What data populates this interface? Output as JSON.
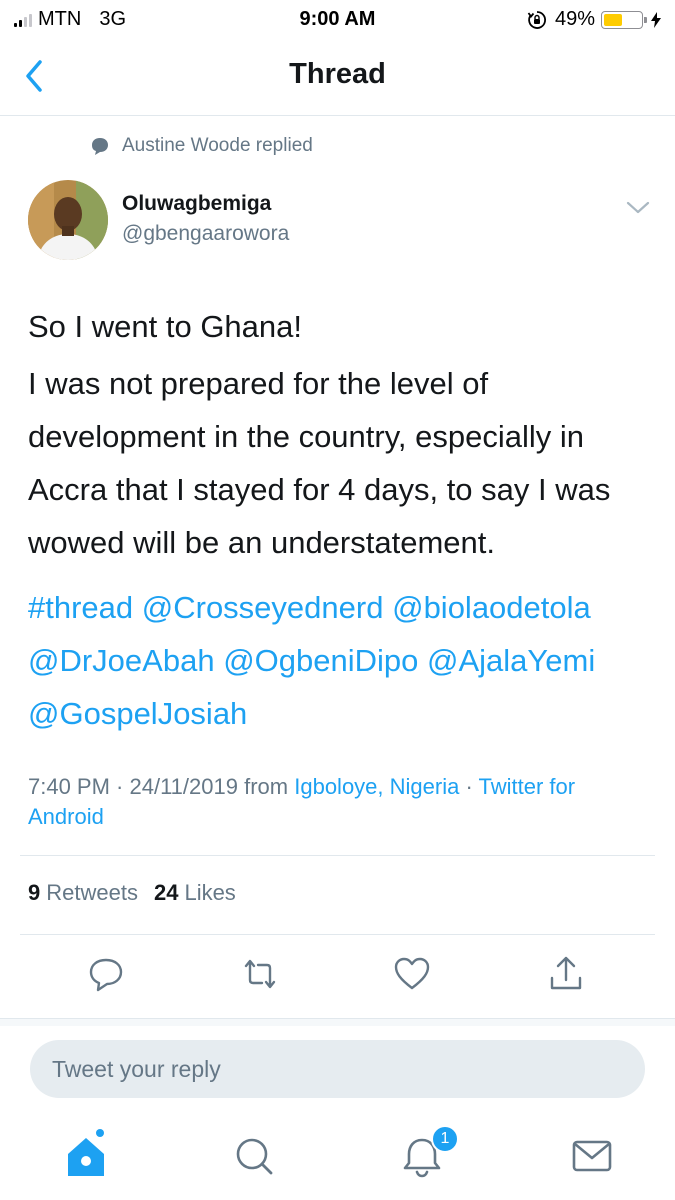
{
  "status_bar": {
    "carrier": "MTN",
    "network": "3G",
    "time": "9:00 AM",
    "battery_percent": "49%",
    "battery_level": 0.49,
    "signal_bars": 2,
    "icons": [
      "signal-icon",
      "orientation-lock-icon",
      "battery-icon",
      "charging-bolt-icon"
    ]
  },
  "nav": {
    "title": "Thread",
    "back_icon": "chevron-left-icon"
  },
  "tweet": {
    "reply_context": "Austine Woode replied",
    "author_name": "Oluwagbemiga",
    "author_handle": "@gbengaarowora",
    "line1": "So I went to Ghana!",
    "line2": "I was not prepared for the level of development in the country, especially in Accra that I stayed for 4 days, to say I was wowed will be an understatement.",
    "hashtag": "#thread",
    "mentions": [
      "@Crosseyednerd",
      "@biolaodetola",
      "@DrJoeAbah",
      "@OgbeniDipo",
      "@AjalaYemi",
      "@GospelJosiah"
    ],
    "time": "7:40 PM",
    "date": "24/11/2019",
    "from_label": "from",
    "location": "Igboloye, Nigeria",
    "client": "Twitter for Android",
    "retweets_count": "9",
    "retweets_label": "Retweets",
    "likes_count": "24",
    "likes_label": "Likes"
  },
  "reply": {
    "placeholder": "Tweet your reply"
  },
  "tab_bar": {
    "tabs": [
      "home-icon",
      "search-icon",
      "notifications-icon",
      "messages-icon"
    ],
    "notifications_badge": "1"
  },
  "colors": {
    "accent": "#1da1f2",
    "text": "#14171a",
    "secondary": "#657786",
    "border": "#e1e8ed"
  }
}
